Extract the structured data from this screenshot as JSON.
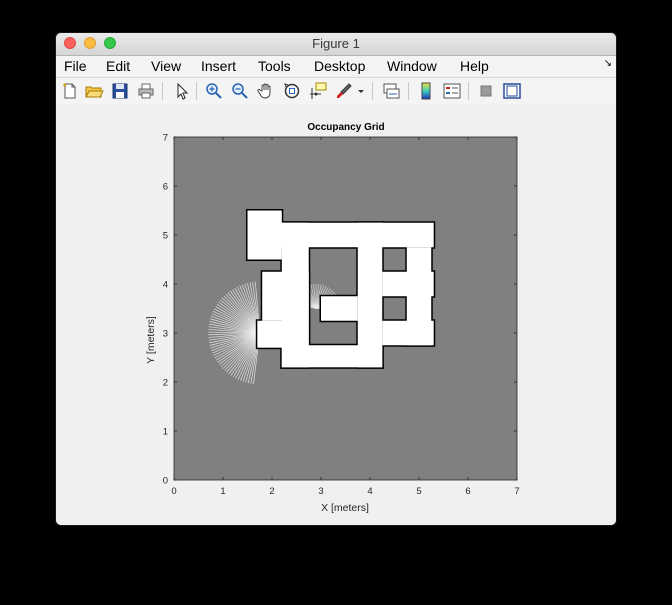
{
  "window": {
    "title": "Figure 1"
  },
  "menu": {
    "items": [
      "File",
      "Edit",
      "View",
      "Insert",
      "Tools",
      "Desktop",
      "Window",
      "Help"
    ]
  },
  "toolbar": {
    "icons": [
      "new-figure-icon",
      "open-file-icon",
      "save-icon",
      "print-icon",
      "pointer-icon",
      "zoom-in-icon",
      "zoom-out-icon",
      "pan-hand-icon",
      "rotate-3d-icon",
      "data-cursor-icon",
      "brush-icon",
      "brush-dropdown-icon",
      "link-plot-icon",
      "colorbar-icon",
      "legend-icon",
      "hide-plot-tools-icon",
      "show-plot-tools-icon"
    ]
  },
  "chart_data": {
    "type": "heatmap",
    "title": "Occupancy Grid",
    "xlabel": "X [meters]",
    "ylabel": "Y [meters]",
    "xlim": [
      0,
      7
    ],
    "ylim": [
      0,
      7
    ],
    "xticks": [
      "0",
      "1",
      "2",
      "3",
      "4",
      "5",
      "6",
      "7"
    ],
    "yticks": [
      "0",
      "1",
      "2",
      "3",
      "4",
      "5",
      "6",
      "7"
    ],
    "colors": {
      "unknown": "#808080",
      "free": "#ffffff",
      "occupied": "#000000"
    },
    "free_regions": [
      {
        "x": [
          1.5,
          2.2
        ],
        "y": [
          4.5,
          5.5
        ]
      },
      {
        "x": [
          1.8,
          5.3
        ],
        "y": [
          4.75,
          5.25
        ]
      },
      {
        "x": [
          2.2,
          2.75
        ],
        "y": [
          2.3,
          5.25
        ]
      },
      {
        "x": [
          1.8,
          2.75
        ],
        "y": [
          3.25,
          4.25
        ]
      },
      {
        "x": [
          1.7,
          2.75
        ],
        "y": [
          2.7,
          3.25
        ]
      },
      {
        "x": [
          2.2,
          4.25
        ],
        "y": [
          2.3,
          2.75
        ]
      },
      {
        "x": [
          3.75,
          4.25
        ],
        "y": [
          2.3,
          5.25
        ]
      },
      {
        "x": [
          3.0,
          3.75
        ],
        "y": [
          3.25,
          3.75
        ]
      },
      {
        "x": [
          4.25,
          5.3
        ],
        "y": [
          3.75,
          4.25
        ]
      },
      {
        "x": [
          4.25,
          5.3
        ],
        "y": [
          2.75,
          3.25
        ]
      },
      {
        "x": [
          4.75,
          5.25
        ],
        "y": [
          2.75,
          4.75
        ]
      }
    ],
    "scan_origin": {
      "x": 1.75,
      "y": 3.0
    }
  }
}
